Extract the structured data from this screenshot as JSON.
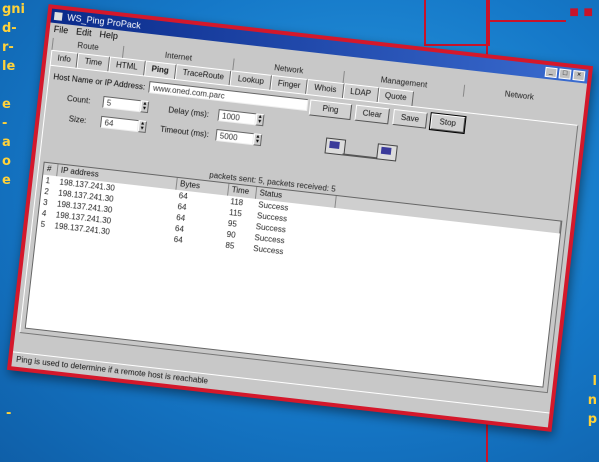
{
  "window": {
    "title": "WS_Ping ProPack"
  },
  "menu": [
    "File",
    "Edit",
    "Help"
  ],
  "tab_groups": [
    "Route",
    "Internet",
    "Network",
    "Management",
    "Network"
  ],
  "tabs": [
    "Info",
    "Time",
    "HTML",
    "Ping",
    "TraceRoute",
    "Lookup",
    "Finger",
    "Whois",
    "LDAP",
    "Quote"
  ],
  "active_tab": "Ping",
  "form": {
    "host_label": "Host Name or IP Address:",
    "host_value": "www.oned.com.parc",
    "count_label": "Count:",
    "count_value": "5",
    "size_label": "Size:",
    "size_value": "64",
    "delay_label": "Delay (ms):",
    "delay_value": "1000",
    "timeout_label": "Timeout (ms):",
    "timeout_value": "5000",
    "buttons": [
      "Ping",
      "Clear",
      "Save",
      "Stop"
    ]
  },
  "status_line": "packets sent: 5, packets received: 5",
  "table": {
    "headers": [
      "#",
      "IP address",
      "Bytes",
      "Time",
      "Status"
    ],
    "rows": [
      [
        "1",
        "198.137.241.30",
        "64",
        "118",
        "Success"
      ],
      [
        "2",
        "198.137.241.30",
        "64",
        "115",
        "Success"
      ],
      [
        "3",
        "198.137.241.30",
        "64",
        "95",
        "Success"
      ],
      [
        "4",
        "198.137.241.30",
        "64",
        "90",
        "Success"
      ],
      [
        "5",
        "198.137.241.30",
        "64",
        "85",
        "Success"
      ]
    ]
  },
  "statusbar_text": "Ping is used to determine if a remote host is reachable",
  "page": {
    "left_text": "gni\nd-\nr-\nle\n\ne\n-\na\no\ne",
    "right_text": "l\nn\np",
    "bottom_text": "-",
    "accent": "#d4182b",
    "text_color": "#ffd23a"
  }
}
